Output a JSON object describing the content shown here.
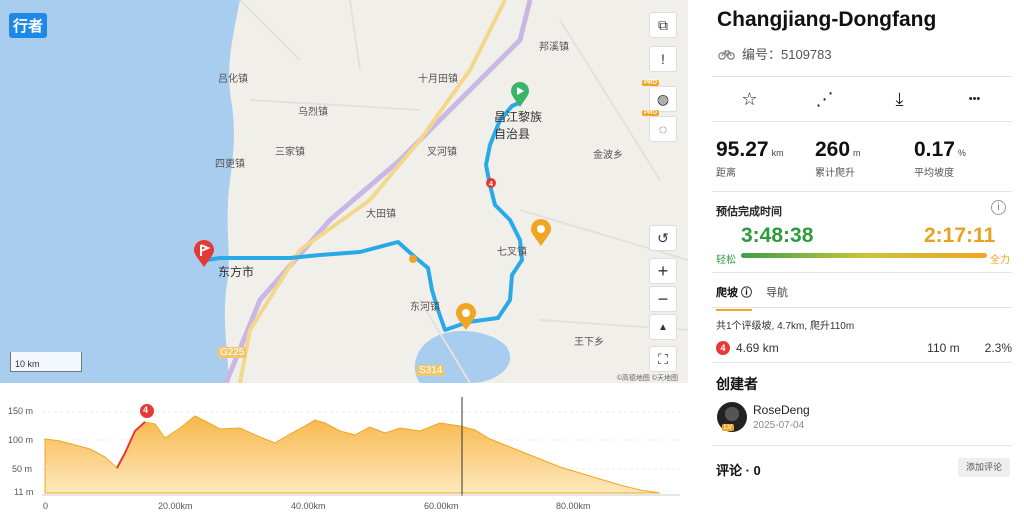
{
  "brand": "行者",
  "map": {
    "scale_label": "10 km",
    "copyright": "©高德地图 ©天地图",
    "labels": [
      "吕化镇",
      "十月田镇",
      "邦溪镇",
      "乌烈镇",
      "三家镇",
      "叉河镇",
      "金波乡",
      "四更镇",
      "大田镇",
      "七叉镇",
      "东方市",
      "东河镇",
      "王下乡",
      "G225",
      "S314",
      "昌江黎族自治县"
    ],
    "controls": {
      "layers": "⧉",
      "feedback": "!",
      "globe": "◍",
      "satellite": "◌",
      "reset": "↺",
      "zoom_in": "+",
      "zoom_out": "−",
      "compass": "▲",
      "fullscreen": "⛶"
    },
    "pro_badge": "PRO"
  },
  "profile": {
    "y_ticks": [
      "150 m",
      "100 m",
      "50 m",
      "11 m"
    ],
    "x_ticks": [
      "0",
      "20.00km",
      "40.00km",
      "60.00km",
      "80.00km"
    ],
    "climb_badge": "4"
  },
  "route": {
    "title": "Changjiang-Dongfang",
    "id_label": "编号：5109783",
    "actions": {
      "favorite": "☆",
      "share": "⋰",
      "download": "⤓",
      "more": "•••"
    },
    "stats": [
      {
        "value": "95.27",
        "unit": "km",
        "label": "距离"
      },
      {
        "value": "260",
        "unit": "m",
        "label": "累计爬升"
      },
      {
        "value": "0.17",
        "unit": "%",
        "label": "平均坡度"
      }
    ],
    "eta": {
      "title": "预估完成时间",
      "easy_time": "3:48:38",
      "hard_time": "2:17:11",
      "easy_label": "轻松",
      "hard_label": "全力",
      "info": "i"
    },
    "tabs": {
      "climb": "爬坡 ⓘ",
      "nav": "导航"
    },
    "climb_summary": "共1个评级坡, 4.7km, 爬升110m",
    "climb": {
      "badge": "4",
      "distance": "4.69 km",
      "gain": "110 m",
      "grade": "2.3%"
    },
    "creator": {
      "title": "创建者",
      "name": "RoseDeng",
      "date": "2025-07-04",
      "level": "LV"
    },
    "comments": {
      "label": "评论 · 0",
      "add": "添加评论"
    }
  }
}
